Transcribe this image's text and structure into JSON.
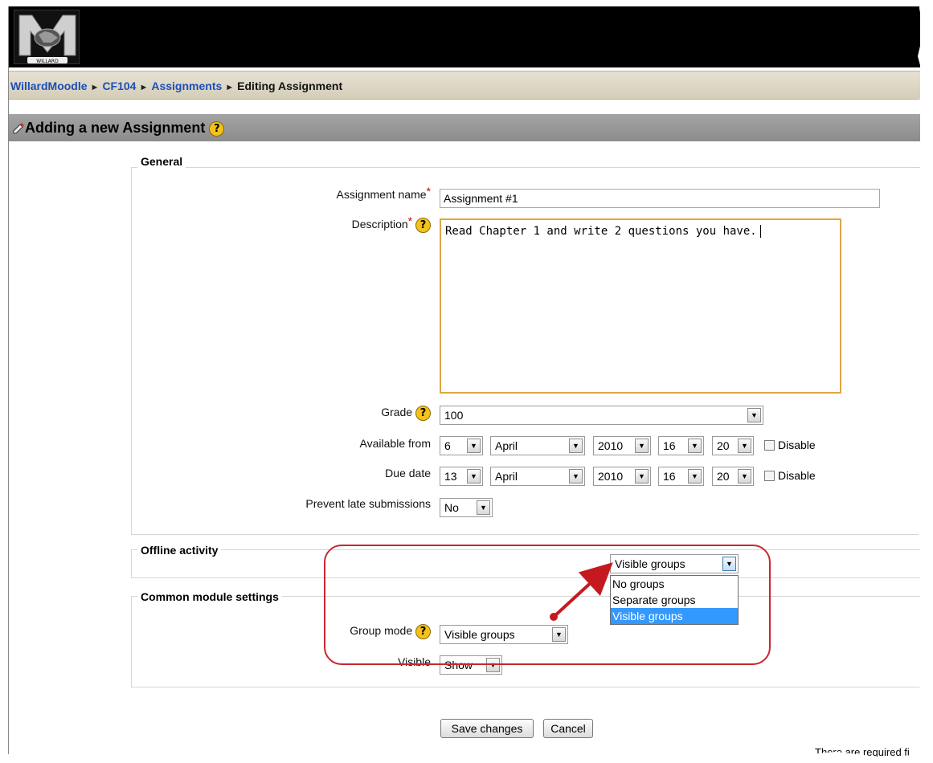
{
  "breadcrumb": {
    "items": [
      "WillardMoodle",
      "CF104",
      "Assignments"
    ],
    "current": "Editing Assignment",
    "separator": "►"
  },
  "page_title": "Adding a new Assignment",
  "help_glyph": "?",
  "general": {
    "legend": "General",
    "assignment_name_label": "Assignment name",
    "assignment_name_value": "Assignment #1",
    "description_label": "Description",
    "description_value": "Read Chapter 1 and write 2 questions you have.",
    "required_mark": "*",
    "grade_label": "Grade",
    "grade_value": "100",
    "available_from_label": "Available from",
    "available_from": {
      "day": "6",
      "month": "April",
      "year": "2010",
      "hour": "16",
      "minute": "20"
    },
    "due_date_label": "Due date",
    "due_date": {
      "day": "13",
      "month": "April",
      "year": "2010",
      "hour": "16",
      "minute": "20"
    },
    "disable_label": "Disable",
    "prevent_late_label": "Prevent late submissions",
    "prevent_late_value": "No"
  },
  "offline": {
    "legend": "Offline activity"
  },
  "common": {
    "legend": "Common module settings",
    "group_mode_label": "Group mode",
    "group_mode_value": "Visible groups",
    "visible_label": "Visible",
    "visible_value": "Show"
  },
  "group_dropdown": {
    "selected": "Visible groups",
    "options": [
      "No groups",
      "Separate groups",
      "Visible groups"
    ]
  },
  "buttons": {
    "save": "Save changes",
    "cancel": "Cancel"
  },
  "footnote": "There are required fi",
  "colors": {
    "link": "#1b4fb8",
    "required": "#d00000",
    "highlight": "#c8282f",
    "selection": "#3399ff",
    "help_icon": "#f4c21a"
  }
}
